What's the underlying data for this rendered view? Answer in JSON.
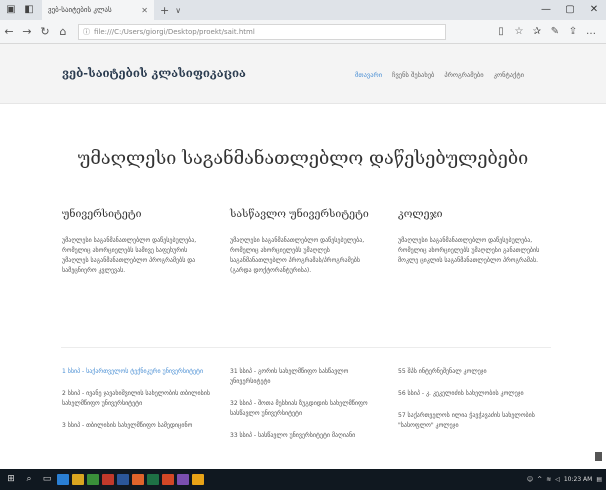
{
  "browser": {
    "tab_title": "ვებ-საიტების კლას",
    "url": "file:///C:/Users/giorgi/Desktop/proekt/sait.html",
    "reading_icon": "book-icon"
  },
  "header": {
    "brand": "ვებ-საიტების კლასიფიკაცია",
    "menu": [
      "მთავარი",
      "ჩვენს შესახებ",
      "პროგრამები",
      "კონტაქტი"
    ]
  },
  "main": {
    "title": "უმაღლესი საგანმანათლებლო დაწესებულებები",
    "columns": [
      {
        "heading": "უნივერსიტეტი",
        "text": "უმაღლესი საგანმანათლებლო დაწესებულება, რომელიც ახორციელებს სამივე საფეხურის უმაღლეს საგანმანათლებლო პროგრამებს და სამეცნიერო კვლევას."
      },
      {
        "heading": "სასწავლო უნივერსიტეტი",
        "text": "უმაღლესი საგანმანათლებლო დაწესებულება, რომელიც ახორციელებს უმაღლეს საგანმანათლებლო პროგრამას/პროგრამებს (გარდა დოქტორანტურისა)."
      },
      {
        "heading": "კოლეჯი",
        "text": "უმაღლესი საგანმანათლებლო დაწესებულება, რომელიც ახორციელებს უმაღლესი განათლების მოკლე ციკლის საგანმანათლებლო პროგრამას."
      }
    ],
    "lists": [
      [
        "1 სსიპ - საქართველოს ტექნიკური უნივერსიტეტი",
        "2 სსიპ - ივანე ჯავახიშვილის სახელობის თბილისის სახელმწიფო უნივერსიტეტი",
        "3 სსიპ - თბილისის სახელმწიფო სამედიცინო"
      ],
      [
        "31 სსიპ - გორის სახელმწიფო სასწავლო უნივერსიტეტი",
        "32 სსიპ - შოთა მესხიას ზუგდიდის სახელმწიფო სასწავლო უნივერსიტეტი",
        "33 სსიპ - სასწავლო უნივერსიტეტი მაღიანი"
      ],
      [
        "55 შპს ინტერნეშენალ კოლეჯი",
        "56 სსიპ - კ. კეკელიძის სახელობის კოლეჯი",
        "57 საქართველოს ილია ჭავჭავაძის სახელობის \"სასოფლო\" კოლეჯი"
      ]
    ]
  },
  "taskbar": {
    "clock": "10:23 AM"
  },
  "colors": {
    "accent": "#4a8fd4",
    "taskbar": "#101820"
  }
}
